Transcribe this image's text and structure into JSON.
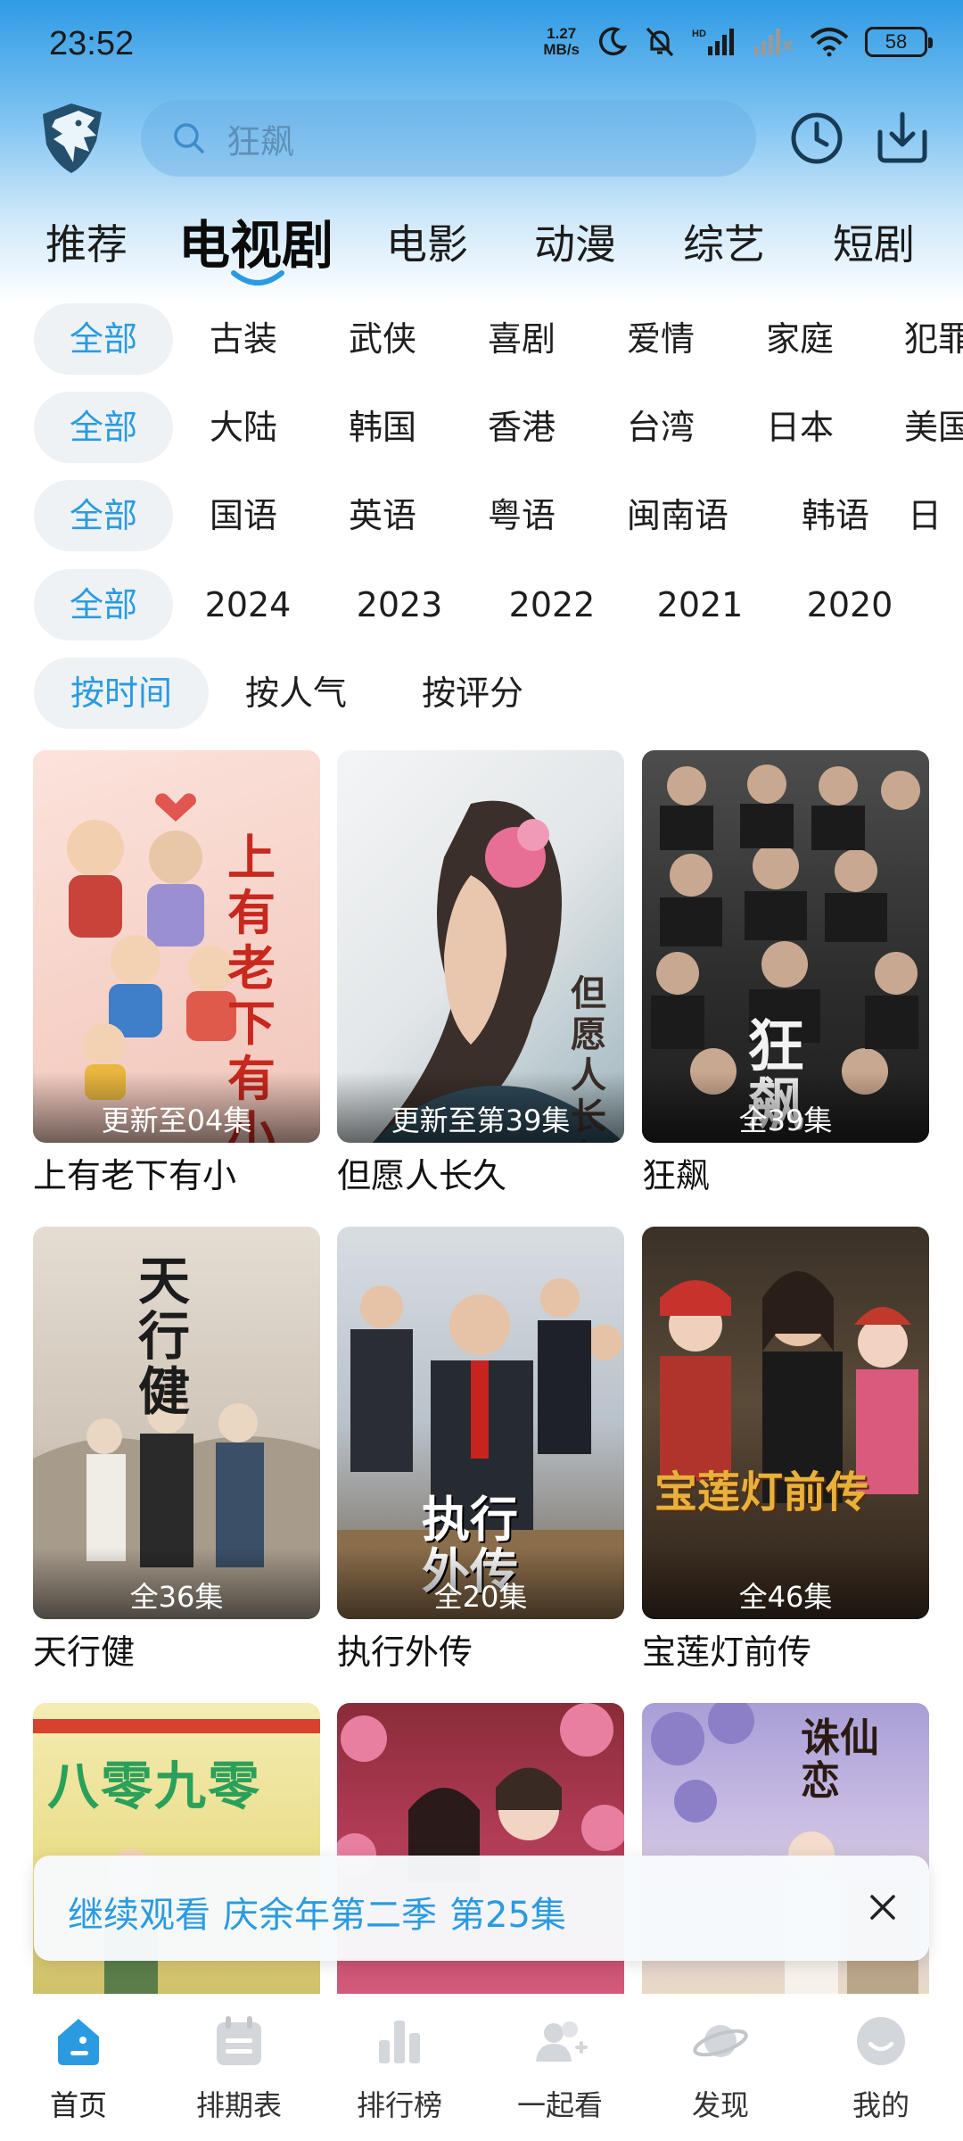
{
  "status_bar": {
    "time": "23:52",
    "net_speed_value": "1.27",
    "net_speed_unit": "MB/s",
    "battery": "58"
  },
  "header": {
    "search_placeholder": "狂飙"
  },
  "tabs": [
    {
      "label": "推荐",
      "active": false
    },
    {
      "label": "电视剧",
      "active": true
    },
    {
      "label": "电影",
      "active": false
    },
    {
      "label": "动漫",
      "active": false
    },
    {
      "label": "综艺",
      "active": false
    },
    {
      "label": "短剧",
      "active": false
    }
  ],
  "filters": {
    "genre": [
      "全部",
      "古装",
      "武侠",
      "喜剧",
      "爱情",
      "家庭",
      "犯罪"
    ],
    "region": [
      "全部",
      "大陆",
      "韩国",
      "香港",
      "台湾",
      "日本",
      "美国"
    ],
    "language": [
      "全部",
      "国语",
      "英语",
      "粤语",
      "闽南语",
      "韩语",
      "日"
    ],
    "year": [
      "全部",
      "2024",
      "2023",
      "2022",
      "2021",
      "2020"
    ],
    "sort": [
      "按时间",
      "按人气",
      "按评分"
    ]
  },
  "shows": [
    {
      "title": "上有老下有小",
      "episodes": "更新至04集",
      "poster_text": "上有老下有小"
    },
    {
      "title": "但愿人长久",
      "episodes": "更新至第39集",
      "poster_text": "但愿人长久"
    },
    {
      "title": "狂飙",
      "episodes": "全39集",
      "poster_text": "狂飙"
    },
    {
      "title": "天行健",
      "episodes": "全36集",
      "poster_text": "天行健"
    },
    {
      "title": "执行外传",
      "episodes": "全20集",
      "poster_text": "执行外传"
    },
    {
      "title": "宝莲灯前传",
      "episodes": "全46集",
      "poster_text": "宝莲灯前传"
    },
    {
      "title": "",
      "episodes": "",
      "poster_text": "八零九零"
    },
    {
      "title": "",
      "episodes": "",
      "poster_text": ""
    },
    {
      "title": "",
      "episodes": "",
      "poster_text": "诛仙恋"
    }
  ],
  "continue_watching": {
    "label": "继续观看",
    "show": "庆余年第二季",
    "episode": "第25集"
  },
  "bottom_nav": [
    {
      "label": "首页",
      "icon": "home-icon",
      "active": true
    },
    {
      "label": "排期表",
      "icon": "calendar-icon",
      "active": false
    },
    {
      "label": "排行榜",
      "icon": "ranking-icon",
      "active": false
    },
    {
      "label": "一起看",
      "icon": "watch-together-icon",
      "active": false
    },
    {
      "label": "发现",
      "icon": "planet-icon",
      "active": false
    },
    {
      "label": "我的",
      "icon": "profile-icon",
      "active": false
    }
  ],
  "colors": {
    "accent": "#2a9be0",
    "header_gradient_top": "#2f9be4",
    "chip_bg": "#eef2f5"
  }
}
